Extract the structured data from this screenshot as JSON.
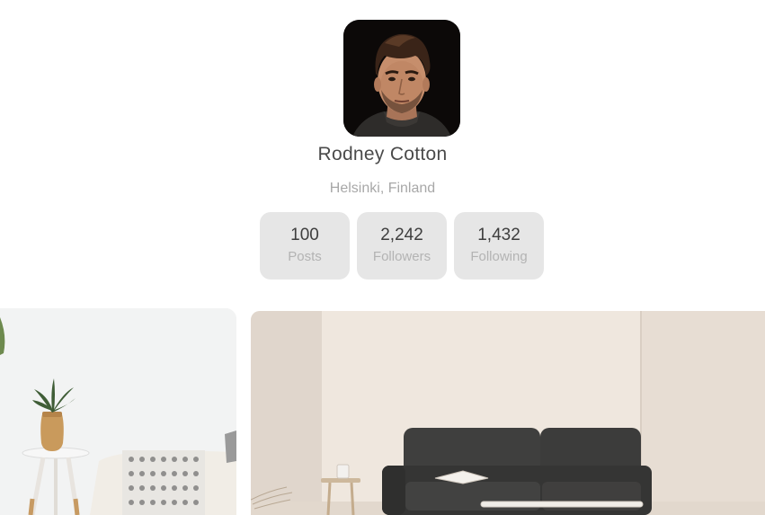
{
  "profile": {
    "name": "Rodney Cotton",
    "location": "Helsinki, Finland",
    "avatar_icon": "portrait-photo"
  },
  "stats": [
    {
      "value": "100",
      "label": "Posts"
    },
    {
      "value": "2,242",
      "label": "Followers"
    },
    {
      "value": "1,432",
      "label": "Following"
    }
  ],
  "gallery": [
    {
      "icon": "interior-photo-plant-stool"
    },
    {
      "icon": "interior-photo-sofa-room"
    }
  ],
  "colors": {
    "stat_card_bg": "#e6e6e6",
    "name_text": "#4a4a4a",
    "muted_text": "#a8a8a8"
  }
}
